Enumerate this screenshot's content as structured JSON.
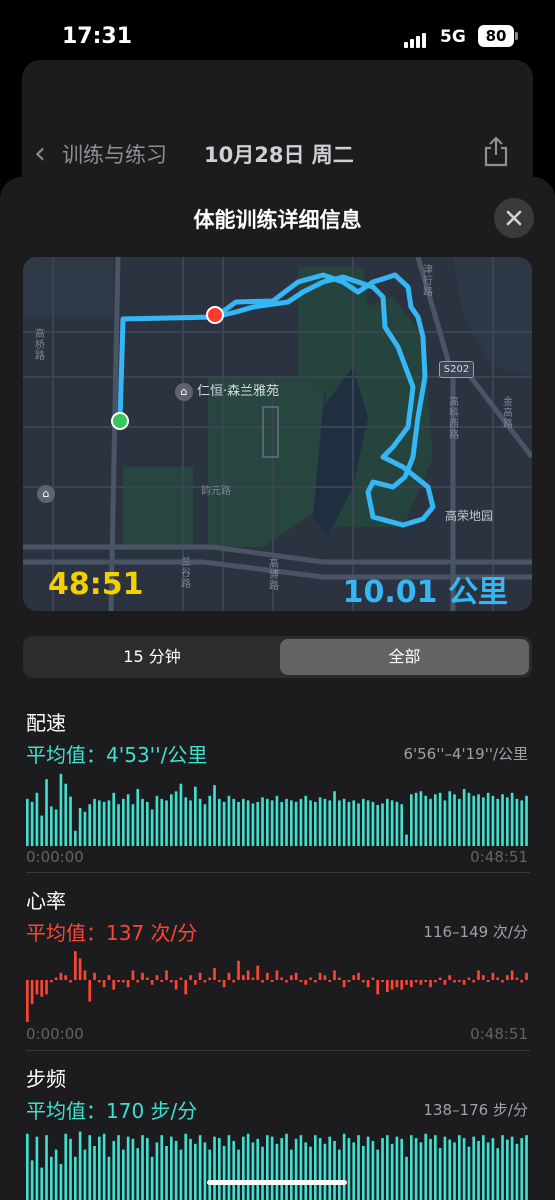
{
  "status_bar": {
    "time": "17:31",
    "network": "5G",
    "battery": "80"
  },
  "nav": {
    "back_label": "训练与练习",
    "title": "10月28日 周二"
  },
  "sheet": {
    "title": "体能训练详细信息"
  },
  "map": {
    "duration": "48:51",
    "distance": "10.01 公里",
    "poi_1": "仁恒·森兰雅苑",
    "road_1": "高桥路",
    "road_2": "韵元路",
    "road_3": "兰谷路",
    "road_4": "高博路",
    "road_5": "高科西路",
    "road_6": "金高路",
    "road_7": "津行路",
    "route_badge": "S202",
    "area_label": "高荣地园"
  },
  "segment": {
    "option_15": "15 分钟",
    "option_all": "全部",
    "selected": "全部"
  },
  "colors": {
    "pace": "#40e0d0",
    "heart": "#ff4531",
    "cadence": "#40e0d0",
    "start_dot": "#34c759",
    "end_dot": "#ff3b30",
    "route": "#35b7f5"
  },
  "pace": {
    "title": "配速",
    "average": "平均值：4'53''/公里",
    "range": "6'56''–4'19''/公里",
    "start_time": "0:00:00",
    "end_time": "0:48:51",
    "chart_data": {
      "type": "bar",
      "unit": "relative",
      "values": [
        0.62,
        0.58,
        0.7,
        0.4,
        0.88,
        0.52,
        0.48,
        0.95,
        0.82,
        0.65,
        0.2,
        0.5,
        0.45,
        0.55,
        0.62,
        0.6,
        0.58,
        0.6,
        0.7,
        0.55,
        0.62,
        0.68,
        0.55,
        0.75,
        0.62,
        0.58,
        0.48,
        0.66,
        0.62,
        0.6,
        0.68,
        0.72,
        0.82,
        0.64,
        0.6,
        0.78,
        0.62,
        0.55,
        0.66,
        0.8,
        0.62,
        0.58,
        0.66,
        0.62,
        0.58,
        0.62,
        0.6,
        0.56,
        0.58,
        0.64,
        0.62,
        0.6,
        0.66,
        0.58,
        0.62,
        0.6,
        0.58,
        0.62,
        0.66,
        0.6,
        0.58,
        0.64,
        0.62,
        0.6,
        0.72,
        0.6,
        0.62,
        0.58,
        0.6,
        0.56,
        0.62,
        0.6,
        0.58,
        0.54,
        0.56,
        0.62,
        0.6,
        0.58,
        0.55,
        0.15,
        0.68,
        0.7,
        0.72,
        0.66,
        0.62,
        0.68,
        0.7,
        0.6,
        0.72,
        0.68,
        0.62,
        0.75,
        0.7,
        0.66,
        0.68,
        0.64,
        0.7,
        0.66,
        0.62,
        0.68,
        0.64,
        0.7,
        0.62,
        0.6,
        0.66
      ]
    }
  },
  "heart": {
    "title": "心率",
    "average": "平均值：137 次/分",
    "range": "116–149 次/分",
    "start_time": "0:00:00",
    "end_time": "0:48:51",
    "chart_data": {
      "type": "bar",
      "unit": "bpm",
      "baseline": 137,
      "values": [
        116,
        127,
        131,
        130,
        131,
        136,
        138,
        140,
        139,
        136,
        149,
        146,
        141,
        128,
        140,
        136,
        134,
        139,
        133,
        137,
        136,
        134,
        141,
        136,
        140,
        138,
        135,
        139,
        137,
        141,
        136,
        133,
        138,
        131,
        139,
        135,
        140,
        136,
        138,
        142,
        137,
        134,
        140,
        136,
        145,
        139,
        141,
        138,
        143,
        136,
        140,
        137,
        141,
        138,
        136,
        139,
        140,
        137,
        135,
        138,
        136,
        140,
        139,
        137,
        141,
        138,
        134,
        137,
        139,
        140,
        136,
        134,
        138,
        131,
        137,
        132,
        133,
        134,
        133,
        135,
        134,
        136,
        135,
        137,
        134,
        136,
        138,
        135,
        139,
        136,
        137,
        135,
        138,
        136,
        141,
        139,
        137,
        140,
        138,
        136,
        139,
        141,
        138,
        136,
        140
      ]
    }
  },
  "cadence": {
    "title": "步频",
    "average": "平均值：170 步/分",
    "range": "138–176 步/分",
    "chart_data": {
      "type": "bar",
      "unit": "relative",
      "values": [
        0.92,
        0.55,
        0.88,
        0.45,
        0.9,
        0.6,
        0.7,
        0.5,
        0.92,
        0.85,
        0.6,
        0.95,
        0.7,
        0.9,
        0.75,
        0.88,
        0.92,
        0.6,
        0.82,
        0.9,
        0.7,
        0.88,
        0.85,
        0.72,
        0.9,
        0.86,
        0.6,
        0.8,
        0.9,
        0.75,
        0.88,
        0.82,
        0.7,
        0.92,
        0.85,
        0.78,
        0.9,
        0.8,
        0.7,
        0.88,
        0.86,
        0.75,
        0.9,
        0.82,
        0.7,
        0.88,
        0.92,
        0.8,
        0.85,
        0.74,
        0.9,
        0.88,
        0.78,
        0.86,
        0.92,
        0.7,
        0.85,
        0.9,
        0.8,
        0.74,
        0.9,
        0.86,
        0.78,
        0.88,
        0.82,
        0.7,
        0.92,
        0.86,
        0.8,
        0.9,
        0.75,
        0.88,
        0.82,
        0.7,
        0.86,
        0.9,
        0.78,
        0.88,
        0.85,
        0.6,
        0.9,
        0.86,
        0.8,
        0.92,
        0.85,
        0.9,
        0.72,
        0.88,
        0.84,
        0.8,
        0.9,
        0.86,
        0.74,
        0.88,
        0.82,
        0.9,
        0.8,
        0.86,
        0.72,
        0.9,
        0.84,
        0.88,
        0.78,
        0.86,
        0.9
      ]
    }
  }
}
